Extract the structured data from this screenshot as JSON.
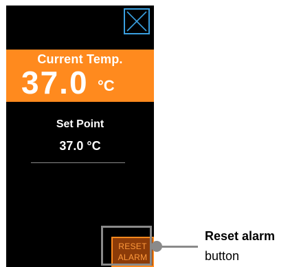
{
  "current_temp": {
    "label": "Current Temp.",
    "value": "37.0",
    "unit": "°C"
  },
  "set_point": {
    "label": "Set Point",
    "value": "37.0 °C"
  },
  "reset_button": {
    "line1": "RESET",
    "line2": "ALARM"
  },
  "callout": {
    "title": "Reset alarm",
    "subtitle": "button"
  },
  "icons": {
    "close": "close-icon"
  },
  "colors": {
    "screen_bg": "#000000",
    "accent_orange": "#ff8a1e",
    "close_blue": "#3aa0e0",
    "reset_bg": "#8c3b08",
    "callout_gray": "#8a8a8a"
  }
}
